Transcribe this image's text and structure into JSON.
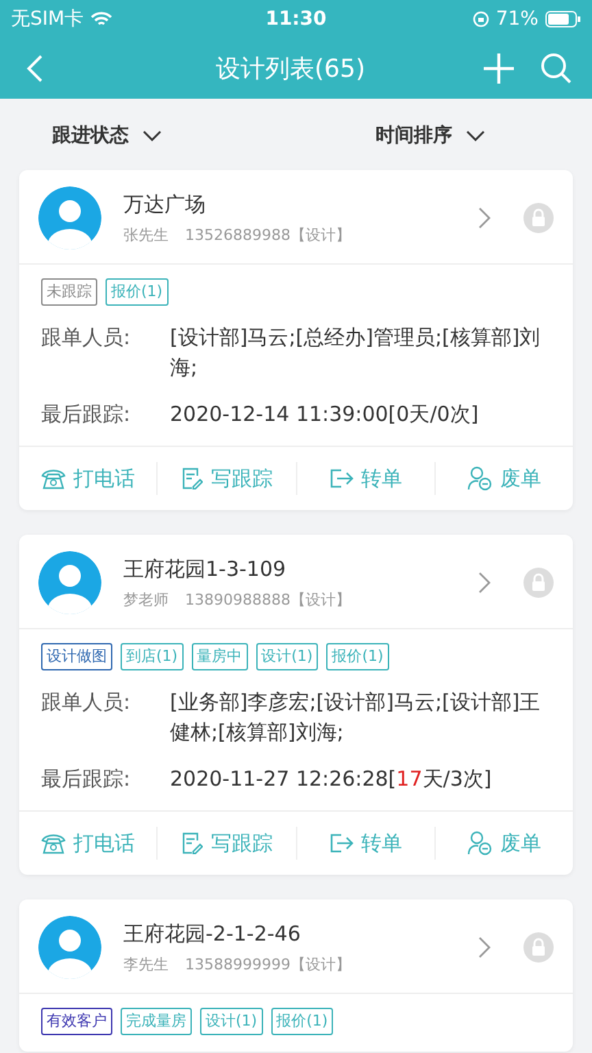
{
  "status_bar": {
    "carrier": "无SIM卡",
    "time": "11:30",
    "battery": "71%"
  },
  "nav": {
    "title": "设计列表(65)"
  },
  "filters": [
    {
      "label": "跟进状态"
    },
    {
      "label": "时间排序"
    }
  ],
  "cards": [
    {
      "name": "万达广场",
      "contact": "张先生",
      "phone": "13526889988【设计】",
      "tags": [
        {
          "label": "未跟踪",
          "color": "#8a8a8a"
        },
        {
          "label": "报价(1)",
          "color": "#3bb3b9"
        }
      ],
      "staff_label": "跟单人员:",
      "staff": "[设计部]马云;[总经办]管理员;[核算部]刘海;",
      "last_label": "最后跟踪:",
      "last_follow": {
        "prefix": "2020-12-14 11:39:00[",
        "days": "0",
        "suffix": "天/0次]",
        "overdue": false
      },
      "actions": [
        "打电话",
        "写跟踪",
        "转单",
        "废单"
      ]
    },
    {
      "name": "王府花园1-3-109",
      "contact": "梦老师",
      "phone": "13890988888【设计】",
      "tags": [
        {
          "label": "设计做图",
          "color": "#2f68b0"
        },
        {
          "label": "到店(1)",
          "color": "#3bb3b9"
        },
        {
          "label": "量房中",
          "color": "#3bb3b9"
        },
        {
          "label": "设计(1)",
          "color": "#3bb3b9"
        },
        {
          "label": "报价(1)",
          "color": "#3bb3b9"
        }
      ],
      "staff_label": "跟单人员:",
      "staff": "[业务部]李彦宏;[设计部]马云;[设计部]王健林;[核算部]刘海;",
      "last_label": "最后跟踪:",
      "last_follow": {
        "prefix": "2020-11-27 12:26:28[",
        "days": "17",
        "suffix": "天/3次]",
        "overdue": true
      },
      "actions": [
        "打电话",
        "写跟踪",
        "转单",
        "废单"
      ]
    },
    {
      "name": "王府花园-2-1-2-46",
      "contact": "李先生",
      "phone": "13588999999【设计】",
      "tags": [
        {
          "label": "有效客户",
          "color": "#3d37b0"
        },
        {
          "label": "完成量房",
          "color": "#3bb3b9"
        },
        {
          "label": "设计(1)",
          "color": "#3bb3b9"
        },
        {
          "label": "报价(1)",
          "color": "#3bb3b9"
        }
      ]
    }
  ]
}
